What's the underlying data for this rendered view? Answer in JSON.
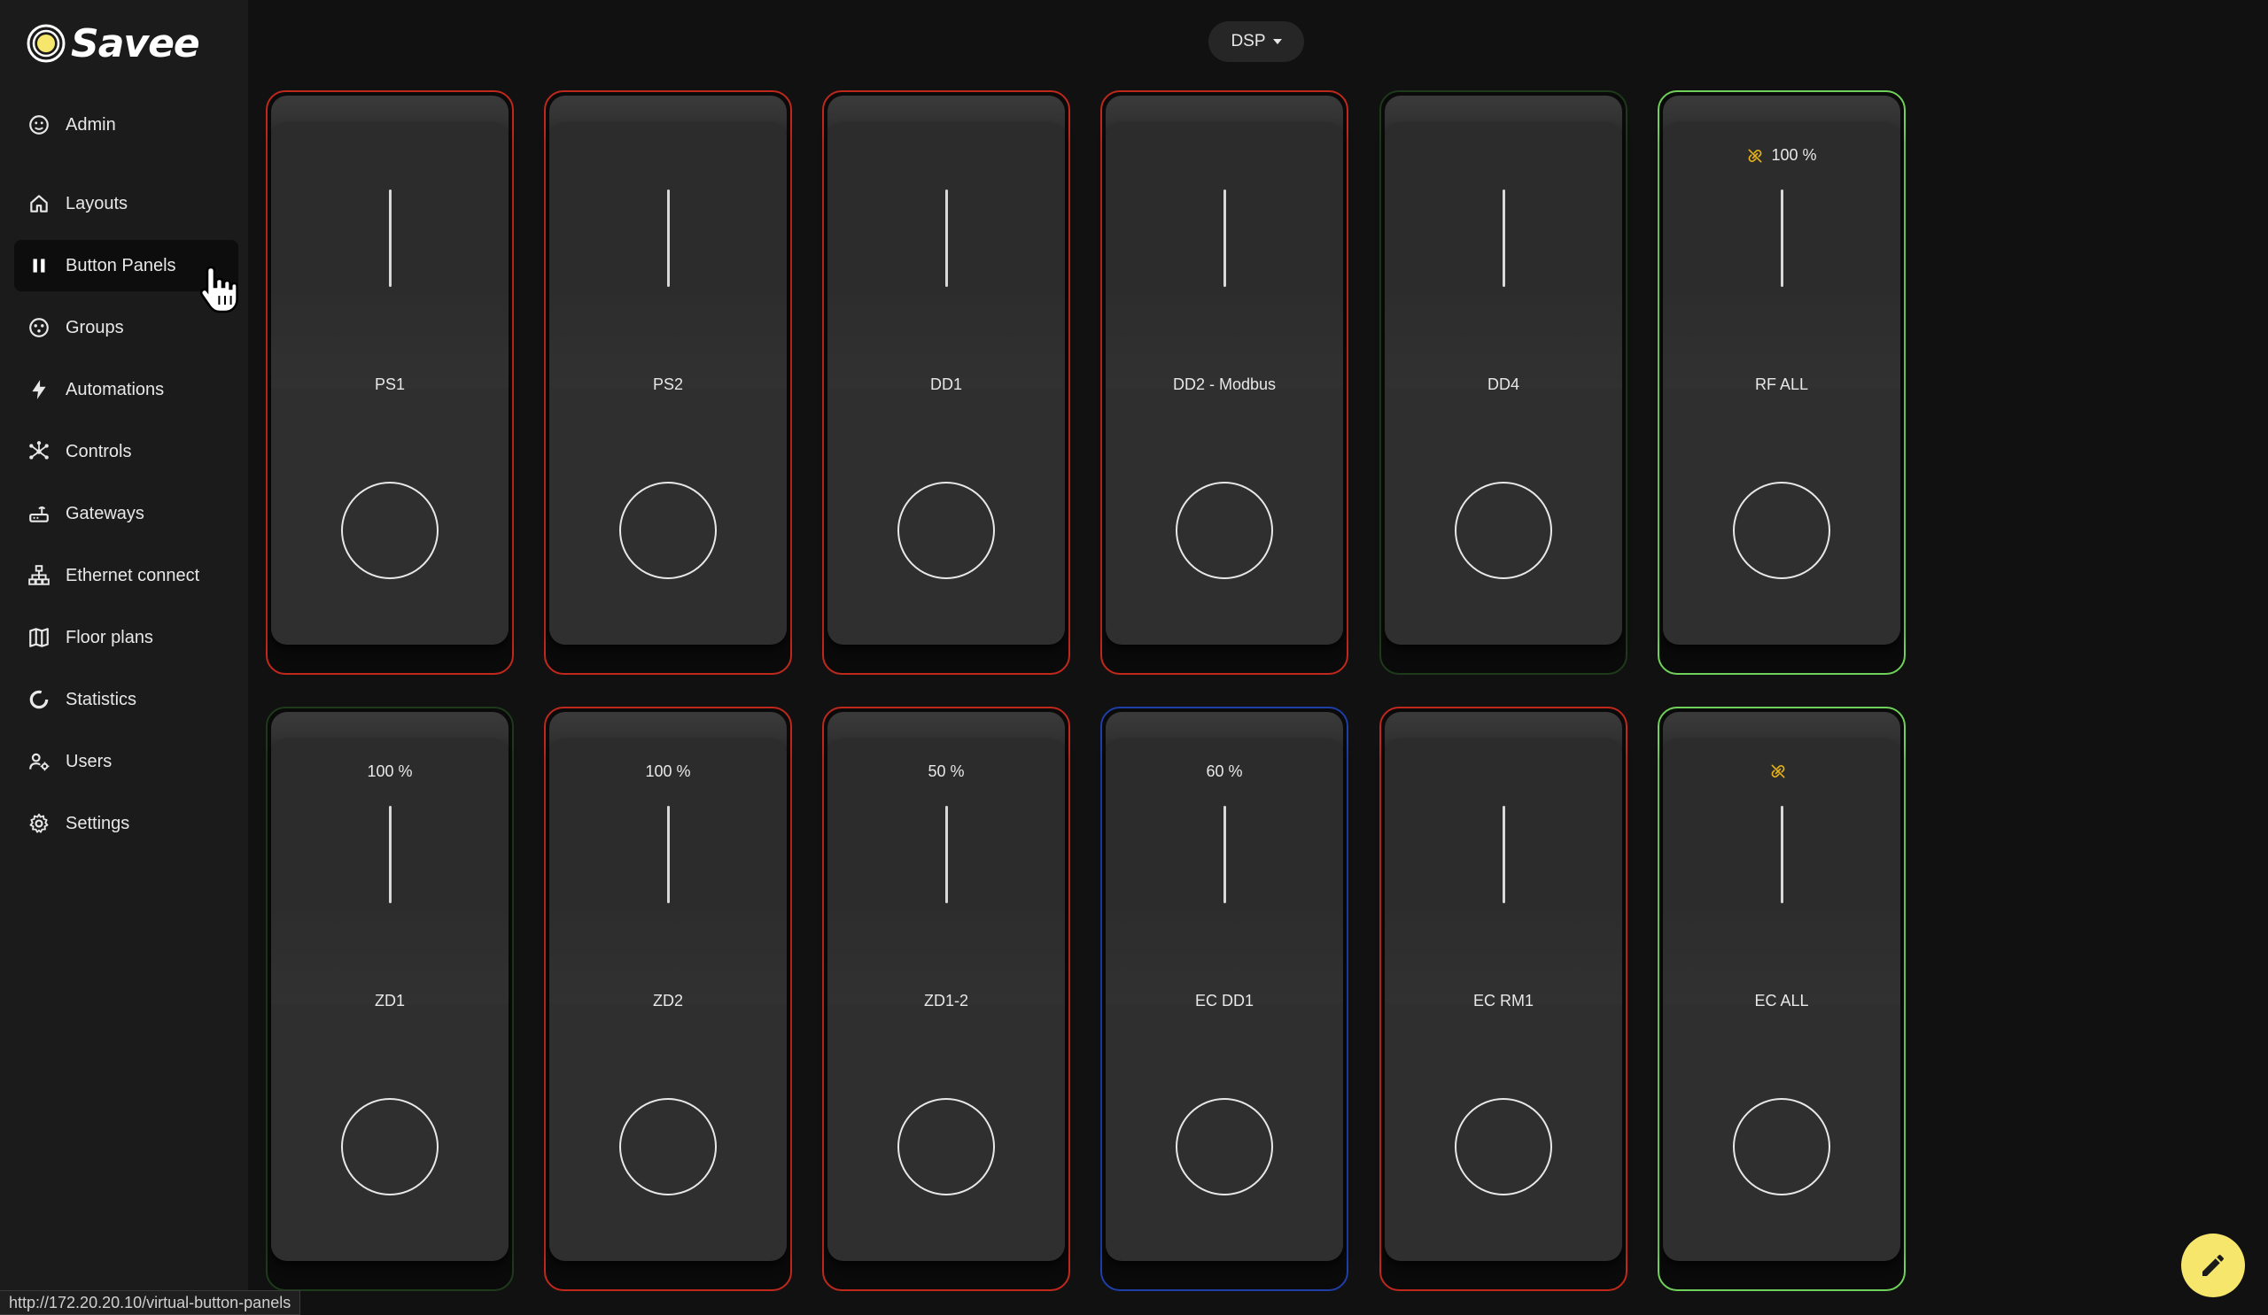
{
  "app": {
    "name": "Savee",
    "brand_color": "#f6e66c"
  },
  "sidebar": {
    "items": [
      {
        "id": "admin",
        "label": "Admin",
        "icon": "user-circle-icon",
        "active": false
      },
      {
        "id": "layouts",
        "label": "Layouts",
        "icon": "home-icon",
        "active": false
      },
      {
        "id": "button-panels",
        "label": "Button Panels",
        "icon": "pause-icon",
        "active": true
      },
      {
        "id": "groups",
        "label": "Groups",
        "icon": "groups-icon",
        "active": false
      },
      {
        "id": "automations",
        "label": "Automations",
        "icon": "lightning-icon",
        "active": false
      },
      {
        "id": "controls",
        "label": "Controls",
        "icon": "network-nodes-icon",
        "active": false
      },
      {
        "id": "gateways",
        "label": "Gateways",
        "icon": "router-icon",
        "active": false
      },
      {
        "id": "ethernet-connect",
        "label": "Ethernet connect",
        "icon": "ethernet-tree-icon",
        "active": false
      },
      {
        "id": "floor-plans",
        "label": "Floor plans",
        "icon": "map-icon",
        "active": false
      },
      {
        "id": "statistics",
        "label": "Statistics",
        "icon": "donut-chart-icon",
        "active": false
      },
      {
        "id": "users",
        "label": "Users",
        "icon": "user-gear-icon",
        "active": false
      },
      {
        "id": "settings",
        "label": "Settings",
        "icon": "gear-icon",
        "active": false
      }
    ]
  },
  "header": {
    "dropdown_value": "DSP"
  },
  "panels": [
    {
      "name": "PS1",
      "level": "",
      "linked_off": false,
      "border_color": "#c0281c"
    },
    {
      "name": "PS2",
      "level": "",
      "linked_off": false,
      "border_color": "#c0281c"
    },
    {
      "name": "DD1",
      "level": "",
      "linked_off": false,
      "border_color": "#c0281c"
    },
    {
      "name": "DD2 - Modbus",
      "level": "",
      "linked_off": false,
      "border_color": "#c0281c"
    },
    {
      "name": "DD4",
      "level": "",
      "linked_off": false,
      "border_color": "#1d3a1a"
    },
    {
      "name": "RF ALL",
      "level": "100 %",
      "linked_off": true,
      "border_color": "#6fd15a"
    },
    {
      "name": "ZD1",
      "level": "100 %",
      "linked_off": false,
      "border_color": "#1d3a1a"
    },
    {
      "name": "ZD2",
      "level": "100 %",
      "linked_off": false,
      "border_color": "#c0281c"
    },
    {
      "name": "ZD1-2",
      "level": "50 %",
      "linked_off": false,
      "border_color": "#c0281c"
    },
    {
      "name": "EC DD1",
      "level": "60 %",
      "linked_off": false,
      "border_color": "#1e3ea8"
    },
    {
      "name": "EC RM1",
      "level": "",
      "linked_off": false,
      "border_color": "#c0281c"
    },
    {
      "name": "EC ALL",
      "level": "",
      "linked_off": true,
      "border_color": "#6fd15a"
    }
  ],
  "status_bar": {
    "url": "http://172.20.20.10/virtual-button-panels"
  },
  "fab": {
    "icon": "pencil-icon"
  }
}
